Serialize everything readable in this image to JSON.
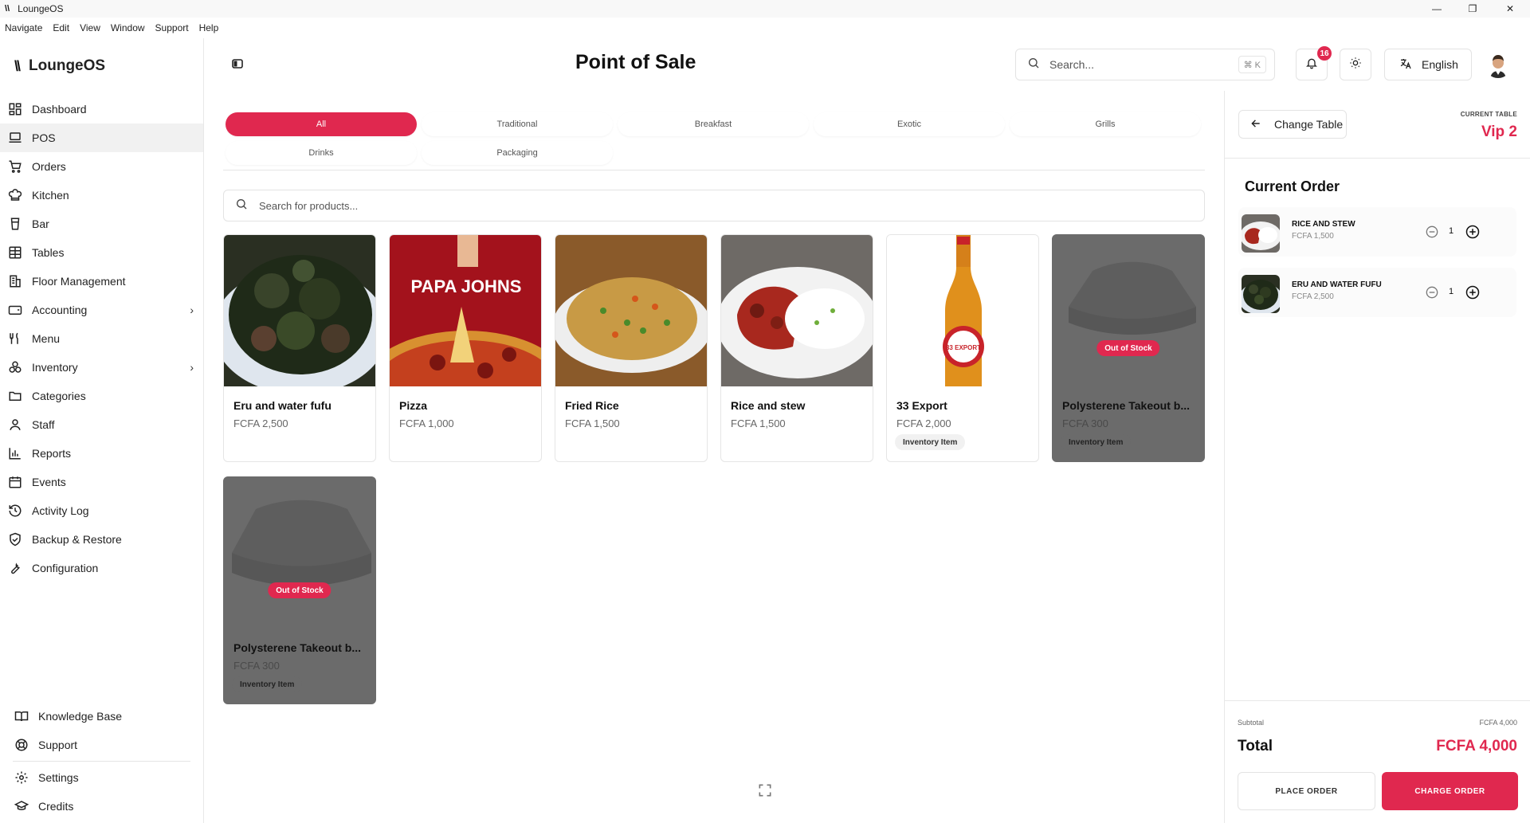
{
  "window": {
    "title": "LoungeOS",
    "minimize": "—",
    "maximize": "❐",
    "close": "✕"
  },
  "menubar": [
    "Navigate",
    "Edit",
    "View",
    "Window",
    "Support",
    "Help"
  ],
  "brand": {
    "logo": "\\\\",
    "name": "LoungeOS"
  },
  "sidebar": {
    "items": [
      {
        "label": "Dashboard",
        "icon": "dashboard-icon"
      },
      {
        "label": "POS",
        "icon": "laptop-icon",
        "active": true
      },
      {
        "label": "Orders",
        "icon": "cart-icon"
      },
      {
        "label": "Kitchen",
        "icon": "chef-hat-icon"
      },
      {
        "label": "Bar",
        "icon": "cup-icon"
      },
      {
        "label": "Tables",
        "icon": "table-grid-icon"
      },
      {
        "label": "Floor Management",
        "icon": "building-icon"
      },
      {
        "label": "Accounting",
        "icon": "wallet-icon",
        "chevron": "›"
      },
      {
        "label": "Menu",
        "icon": "utensils-icon"
      },
      {
        "label": "Inventory",
        "icon": "boxes-icon",
        "chevron": "›"
      },
      {
        "label": "Categories",
        "icon": "folder-icon"
      },
      {
        "label": "Staff",
        "icon": "user-icon"
      },
      {
        "label": "Reports",
        "icon": "bar-chart-icon"
      },
      {
        "label": "Events",
        "icon": "calendar-icon"
      },
      {
        "label": "Activity Log",
        "icon": "history-icon"
      },
      {
        "label": "Backup & Restore",
        "icon": "shield-icon"
      },
      {
        "label": "Configuration",
        "icon": "wrench-icon"
      }
    ],
    "bottom": [
      {
        "label": "Knowledge Base",
        "icon": "book-icon"
      },
      {
        "label": "Support",
        "icon": "lifebuoy-icon"
      },
      {
        "label": "Settings",
        "icon": "gear-icon"
      },
      {
        "label": "Credits",
        "icon": "graduation-cap-icon"
      }
    ]
  },
  "header": {
    "title": "Point of Sale",
    "search_placeholder": "Search...",
    "search_shortcut": "⌘ K",
    "notification_count": "16",
    "language": "English"
  },
  "categories": [
    {
      "label": "All",
      "active": true
    },
    {
      "label": "Traditional"
    },
    {
      "label": "Breakfast"
    },
    {
      "label": "Exotic"
    },
    {
      "label": "Grills"
    },
    {
      "label": "Drinks"
    },
    {
      "label": "Packaging"
    }
  ],
  "product_search_placeholder": "Search for products...",
  "products": [
    {
      "name": "Eru and water fufu",
      "price": "FCFA 2,500",
      "image": "eru-dish"
    },
    {
      "name": "Pizza",
      "price": "FCFA 1,000",
      "image": "pizza",
      "image_text": "PAPA JOHNS"
    },
    {
      "name": "Fried Rice",
      "price": "FCFA 1,500",
      "image": "fried-rice"
    },
    {
      "name": "Rice and stew",
      "price": "FCFA 1,500",
      "image": "rice-stew"
    },
    {
      "name": "33 Export",
      "price": "FCFA 2,000",
      "image": "beer-bottle",
      "badge": "Inventory Item",
      "image_text": "33 EXPORT"
    },
    {
      "name": "Polysterene Takeout b...",
      "price": "FCFA 300",
      "image": "takeout-box",
      "badge": "Inventory Item",
      "out_of_stock": "Out of Stock"
    },
    {
      "name": "Polysterene Takeout b...",
      "price": "FCFA 300",
      "image": "takeout-box",
      "badge": "Inventory Item",
      "out_of_stock": "Out of Stock"
    }
  ],
  "order_panel": {
    "change_table_label": "Change Table",
    "current_table_label": "CURRENT TABLE",
    "current_table_value": "Vip 2",
    "title": "Current Order",
    "items": [
      {
        "name": "RICE AND STEW",
        "price": "FCFA 1,500",
        "qty": "1",
        "image": "rice-stew"
      },
      {
        "name": "ERU AND WATER FUFU",
        "price": "FCFA 2,500",
        "qty": "1",
        "image": "eru-dish"
      }
    ],
    "subtotal_label": "Subtotal",
    "subtotal_value": "FCFA 4,000",
    "total_label": "Total",
    "total_value": "FCFA 4,000",
    "place_order": "PLACE ORDER",
    "charge_order": "CHARGE ORDER"
  },
  "colors": {
    "accent": "#e0284f",
    "out_of_stock_overlay": "#6b6b6b"
  }
}
